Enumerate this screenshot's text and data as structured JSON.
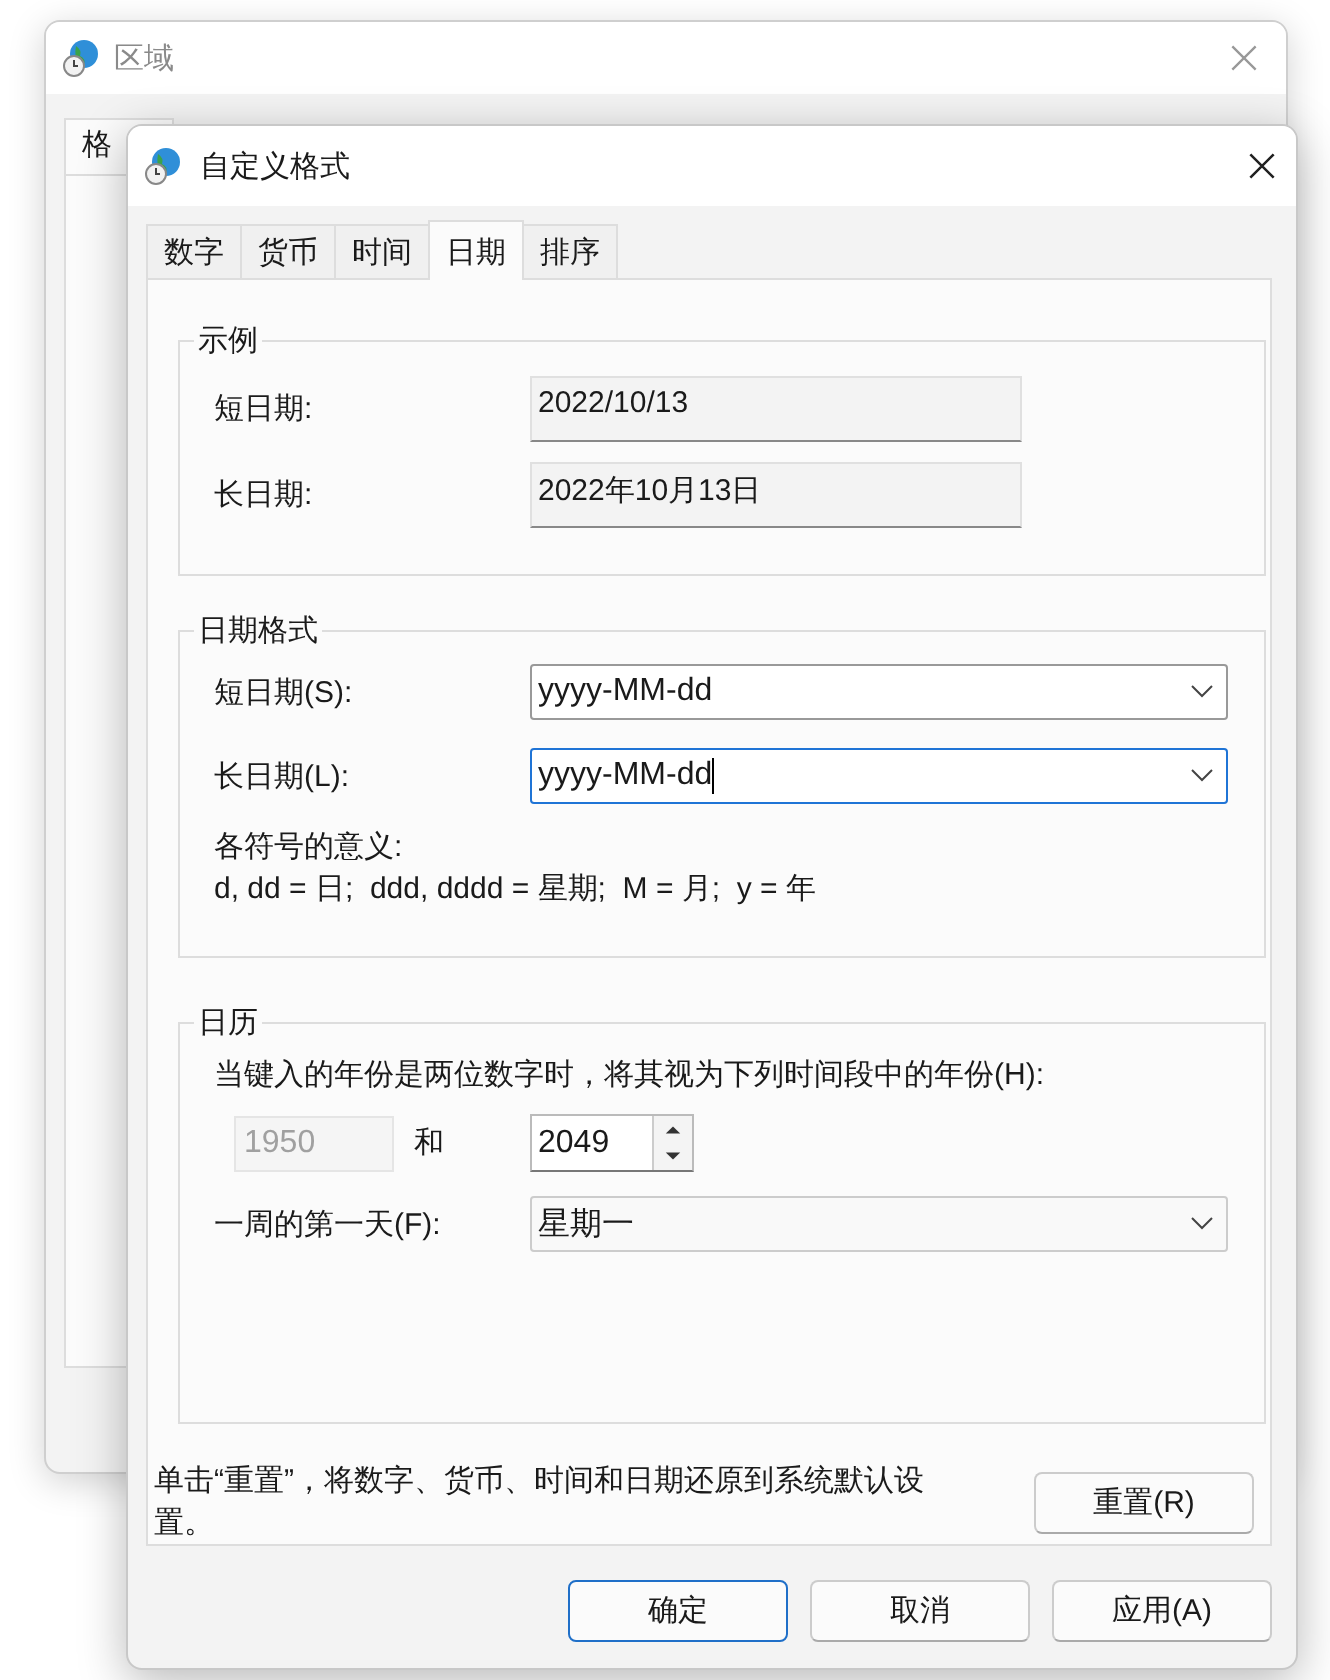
{
  "background_window": {
    "title": "区域",
    "tab": "格"
  },
  "dialog": {
    "title": "自定义格式",
    "tabs": [
      {
        "label": "数字",
        "selected": false
      },
      {
        "label": "货币",
        "selected": false
      },
      {
        "label": "时间",
        "selected": false
      },
      {
        "label": "日期",
        "selected": true
      },
      {
        "label": "排序",
        "selected": false
      }
    ],
    "sample": {
      "title": "示例",
      "rows": [
        {
          "label": "短日期:",
          "value": "2022/10/13"
        },
        {
          "label": "长日期:",
          "value": "2022年10月13日"
        }
      ]
    },
    "format": {
      "title": "日期格式",
      "rows": [
        {
          "label": "短日期(S):",
          "value": "yyyy-MM-dd",
          "focused": false
        },
        {
          "label": "长日期(L):",
          "value": "yyyy-MM-dd",
          "focused": true
        }
      ],
      "legend_title": "各符号的意义:",
      "legend": "d, dd = 日;  ddd, dddd = 星期;  M = 月;  y = 年"
    },
    "calendar": {
      "title": "日历",
      "prompt": "当键入的年份是两位数字时，将其视为下列时间段中的年份(H):",
      "year_from": {
        "value": "1950",
        "disabled": true
      },
      "and": "和",
      "year_to": {
        "value": "2049",
        "disabled": false
      },
      "first_day_label": "一周的第一天(F):",
      "first_day_value": "星期一"
    },
    "reset_note": "单击“重置”，将数字、货币、时间和日期还原到系统默认设置。",
    "reset_button": "重置(R)",
    "buttons": [
      {
        "label": "确定",
        "default": true
      },
      {
        "label": "取消",
        "default": false
      },
      {
        "label": "应用(A)",
        "default": false
      }
    ]
  }
}
